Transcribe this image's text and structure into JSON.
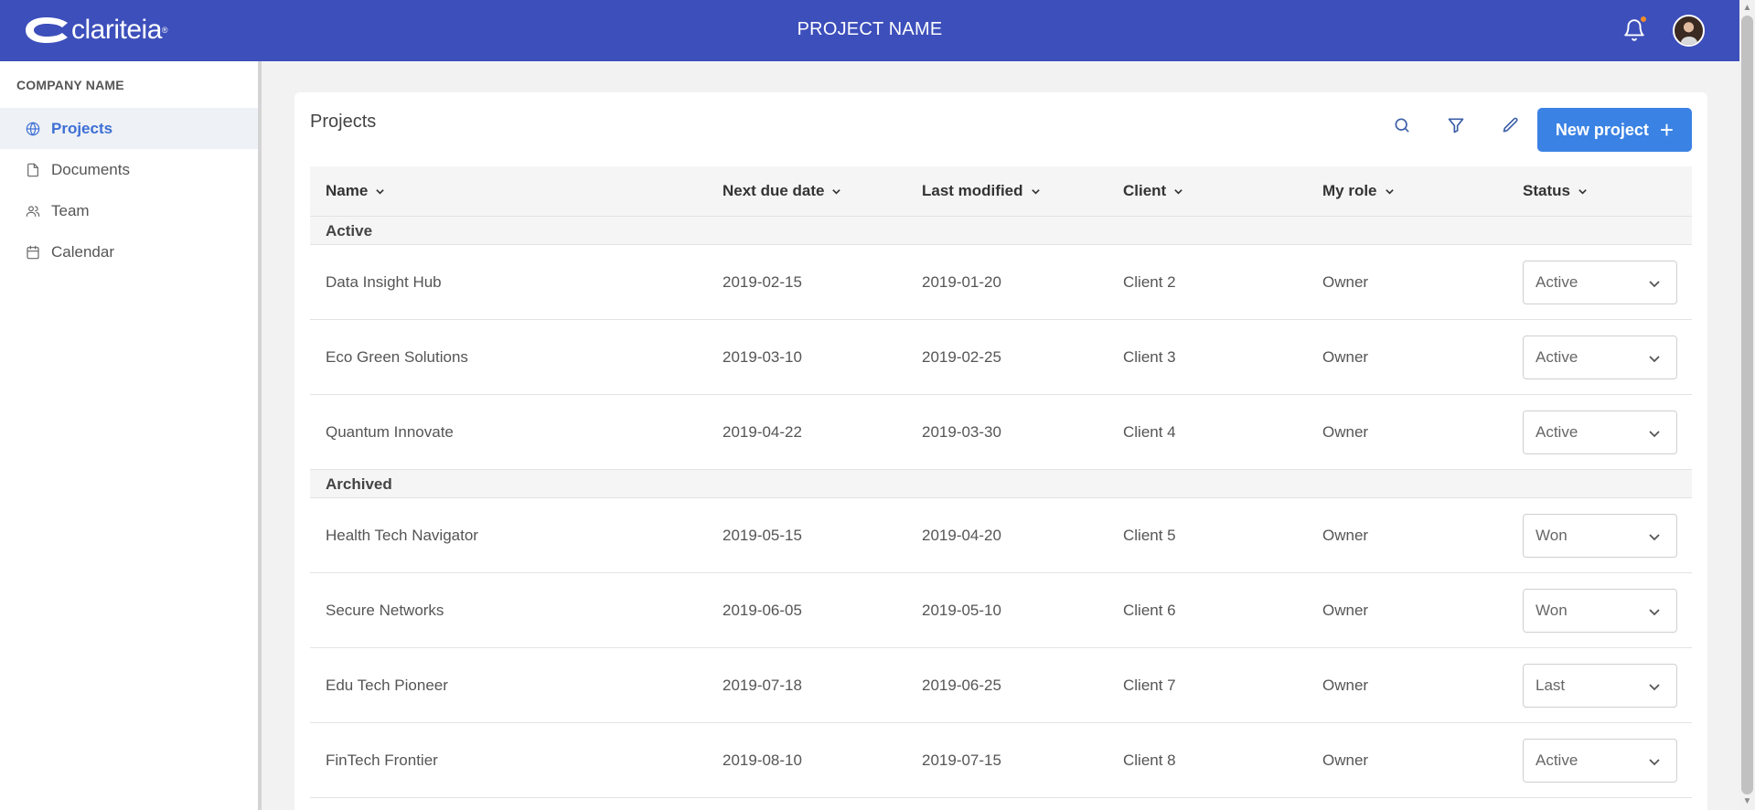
{
  "header": {
    "logo_text": "clariteia",
    "project_title": "PROJECT NAME"
  },
  "sidebar": {
    "company": "COMPANY NAME",
    "items": [
      {
        "label": "Projects",
        "icon": "globe-icon",
        "active": true
      },
      {
        "label": "Documents",
        "icon": "document-icon",
        "active": false
      },
      {
        "label": "Team",
        "icon": "team-icon",
        "active": false
      },
      {
        "label": "Calendar",
        "icon": "calendar-icon",
        "active": false
      }
    ]
  },
  "main": {
    "title": "Projects",
    "new_button": "New project",
    "columns": [
      "Name",
      "Next due date",
      "Last modified",
      "Client",
      "My role",
      "Status"
    ],
    "groups": [
      {
        "label": "Active",
        "rows": [
          {
            "name": "Data Insight Hub",
            "due": "2019-02-15",
            "modified": "2019-01-20",
            "client": "Client 2",
            "role": "Owner",
            "status": "Active"
          },
          {
            "name": "Eco Green Solutions",
            "due": "2019-03-10",
            "modified": "2019-02-25",
            "client": "Client 3",
            "role": "Owner",
            "status": "Active"
          },
          {
            "name": "Quantum Innovate",
            "due": "2019-04-22",
            "modified": "2019-03-30",
            "client": "Client 4",
            "role": "Owner",
            "status": "Active"
          }
        ]
      },
      {
        "label": "Archived",
        "rows": [
          {
            "name": "Health Tech Navigator",
            "due": "2019-05-15",
            "modified": "2019-04-20",
            "client": "Client 5",
            "role": "Owner",
            "status": "Won"
          },
          {
            "name": "Secure Networks",
            "due": "2019-06-05",
            "modified": "2019-05-10",
            "client": "Client 6",
            "role": "Owner",
            "status": "Won"
          },
          {
            "name": "Edu Tech Pioneer",
            "due": "2019-07-18",
            "modified": "2019-06-25",
            "client": "Client 7",
            "role": "Owner",
            "status": "Last"
          },
          {
            "name": "FinTech Frontier",
            "due": "2019-08-10",
            "modified": "2019-07-15",
            "client": "Client 8",
            "role": "Owner",
            "status": "Active"
          }
        ]
      }
    ]
  },
  "colors": {
    "header_bg": "#3d4fbb",
    "accent": "#3a82e4",
    "active_nav": "#3d6fd4",
    "notification_dot": "#f28c28"
  }
}
